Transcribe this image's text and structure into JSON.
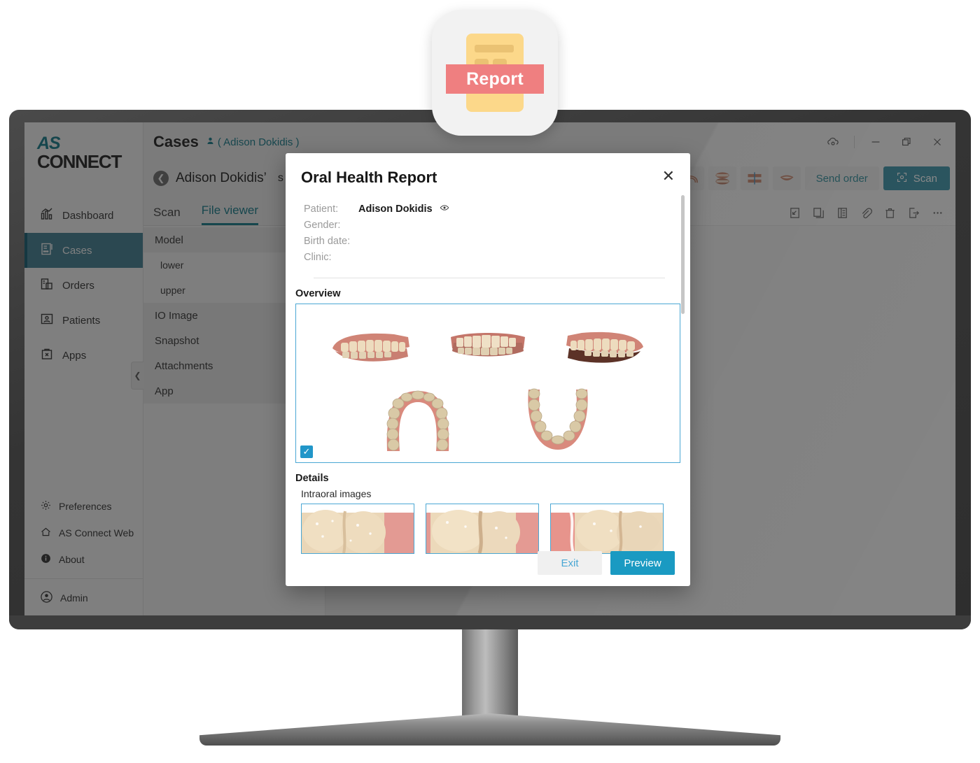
{
  "app_icon": {
    "ribbon_label": "Report",
    "icon_name": "report-document-icon",
    "doc_color": "#fcd88a",
    "ribbon_color": "#ef7f80"
  },
  "sidebar": {
    "logo_top": "AS",
    "logo_bottom": "CONNECT",
    "items": [
      {
        "label": "Dashboard",
        "icon": "chart-bar-icon",
        "active": false
      },
      {
        "label": "Cases",
        "icon": "clipboard-list-icon",
        "active": true
      },
      {
        "label": "Orders",
        "icon": "document-box-icon",
        "active": false
      },
      {
        "label": "Patients",
        "icon": "id-card-icon",
        "active": false
      },
      {
        "label": "Apps",
        "icon": "app-bag-icon",
        "active": false
      }
    ],
    "bottom_items": [
      {
        "label": "Preferences",
        "icon": "gear-icon"
      },
      {
        "label": "AS Connect Web",
        "icon": "home-icon"
      },
      {
        "label": "About",
        "icon": "info-circle-icon"
      }
    ],
    "account": {
      "label": "Admin",
      "icon": "user-circle-icon"
    },
    "collapse_icon": "chevron-left-icon"
  },
  "titlebar": {
    "title": "Cases",
    "subtitle": "( Adison Dokidis )",
    "subtitle_icon": "person-icon",
    "window_controls": [
      {
        "name": "cloud-sync-icon",
        "glyph": "cloud"
      },
      {
        "name": "minimize-icon",
        "glyph": "minimize"
      },
      {
        "name": "restore-icon",
        "glyph": "restore"
      },
      {
        "name": "close-icon",
        "glyph": "close"
      }
    ]
  },
  "casebar": {
    "back_icon": "back-arrow-icon",
    "case_name": "Adison Dokidis’",
    "case_suffix": "s",
    "tools": [
      {
        "name": "upper-arch-icon"
      },
      {
        "name": "both-arches-icon"
      },
      {
        "name": "occlusion-icon"
      },
      {
        "name": "smile-icon"
      }
    ],
    "send_order_label": "Send order",
    "scan_label": "Scan",
    "scan_icon": "scan-frame-icon",
    "scan_button_color": "#1a7f99"
  },
  "tabs": [
    {
      "label": "Scan",
      "active": false
    },
    {
      "label": "File viewer",
      "active": true
    }
  ],
  "tab_tools": [
    {
      "name": "open-external-icon"
    },
    {
      "name": "copy-icon"
    },
    {
      "name": "list-view-icon"
    },
    {
      "name": "attachment-icon"
    },
    {
      "name": "trash-icon"
    },
    {
      "name": "export-icon"
    },
    {
      "name": "more-options-icon"
    }
  ],
  "file_list": [
    {
      "label": "Model",
      "type": "group"
    },
    {
      "label": "lower",
      "type": "child"
    },
    {
      "label": "upper",
      "type": "child"
    },
    {
      "label": "IO Image",
      "type": "group"
    },
    {
      "label": "Snapshot",
      "type": "group"
    },
    {
      "label": "Attachments",
      "type": "group"
    },
    {
      "label": "App",
      "type": "group"
    }
  ],
  "dialog": {
    "title": "Oral Health Report",
    "close_icon": "close-icon",
    "meta": [
      {
        "label": "Patient:",
        "value": "Adison Dokidis",
        "eye_icon": "eye-icon"
      },
      {
        "label": "Gender:",
        "value": ""
      },
      {
        "label": "Birth date:",
        "value": ""
      },
      {
        "label": "Clinic:",
        "value": ""
      }
    ],
    "overview": {
      "title": "Overview",
      "checkbox_checked": true,
      "check_glyph": "✓",
      "accent_color": "#4aa7d4",
      "arches_top": [
        "right-buccal-view",
        "anterior-view",
        "left-buccal-view"
      ],
      "arches_bottom": [
        "upper-occlusal-view",
        "lower-occlusal-view"
      ]
    },
    "details": {
      "title": "Details",
      "intraoral_label": "Intraoral images",
      "thumbs": [
        "intraoral-image-1",
        "intraoral-image-2",
        "intraoral-image-3"
      ]
    },
    "buttons": {
      "exit_label": "Exit",
      "preview_label": "Preview",
      "preview_color": "#1a9ac2",
      "exit_text_color": "#4aa7d4"
    }
  }
}
